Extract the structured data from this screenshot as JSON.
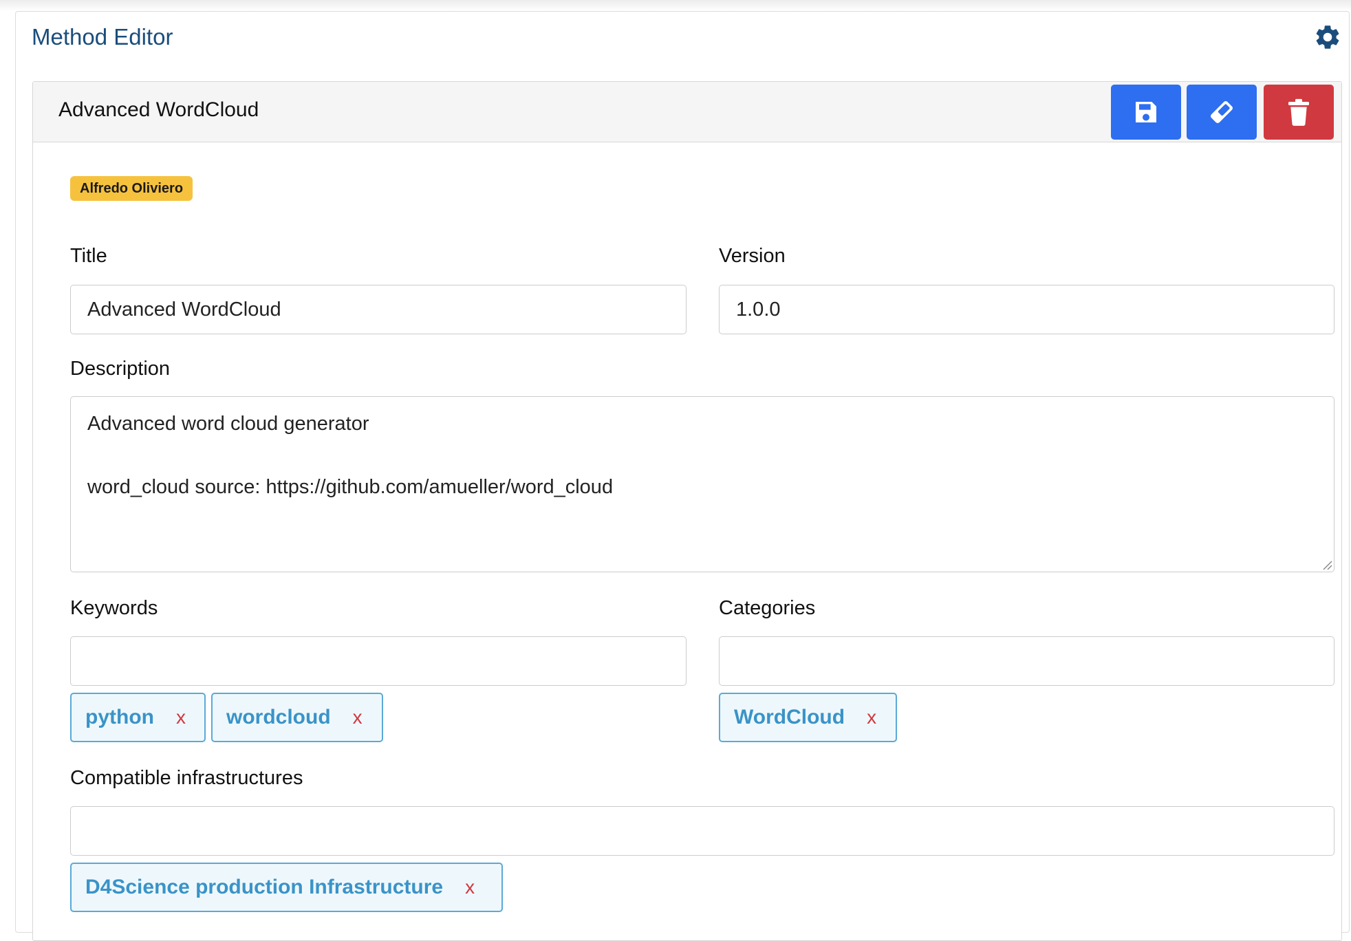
{
  "header": {
    "title": "Method Editor"
  },
  "method": {
    "title": "Advanced WordCloud",
    "author": "Alfredo Oliviero"
  },
  "actions": {
    "save_icon": "floppy-disk-icon",
    "clear_icon": "eraser-icon",
    "delete_icon": "trash-icon"
  },
  "form": {
    "title_label": "Title",
    "title_value": "Advanced WordCloud",
    "version_label": "Version",
    "version_value": "1.0.0",
    "description_label": "Description",
    "description_lines": [
      "Advanced word cloud generator",
      "",
      "word_cloud source: https://github.com/amueller/word_cloud"
    ],
    "keywords_label": "Keywords",
    "keywords_value": "",
    "keywords": [
      {
        "text": "python",
        "remove": "x"
      },
      {
        "text": "wordcloud",
        "remove": "x"
      }
    ],
    "categories_label": "Categories",
    "categories_value": "",
    "categories": [
      {
        "text": "WordCloud",
        "remove": "x"
      }
    ],
    "infra_label": "Compatible infrastructures",
    "infra_value": "",
    "infrastructures": [
      {
        "text": "D4Science production Infrastructure",
        "remove": "x"
      }
    ]
  },
  "colors": {
    "primary": "#2e6ef0",
    "danger": "#d0393f",
    "badge": "#f6c23e",
    "tag_text": "#3a93c8",
    "title": "#1a4d7c"
  }
}
